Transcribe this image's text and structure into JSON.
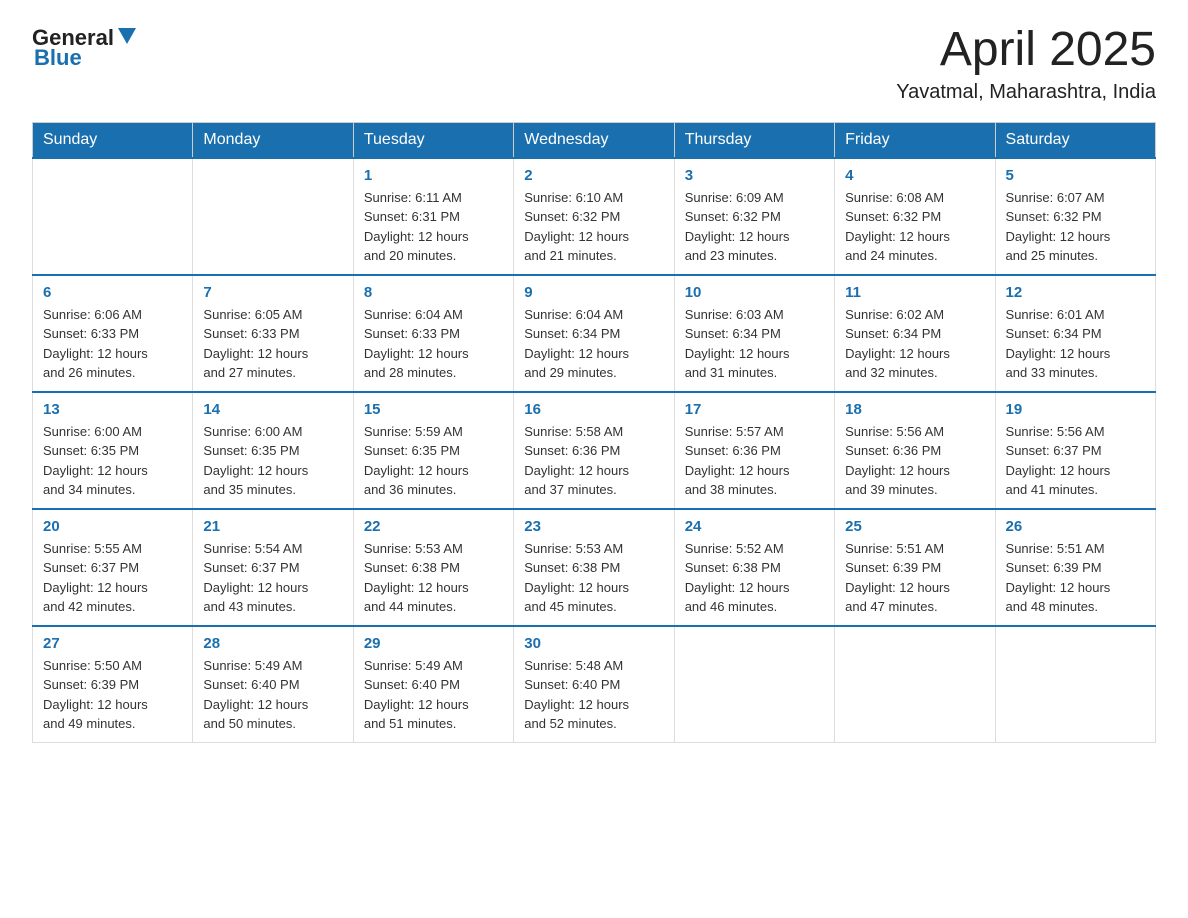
{
  "header": {
    "logo_general": "General",
    "logo_blue": "Blue",
    "month_year": "April 2025",
    "location": "Yavatmal, Maharashtra, India"
  },
  "days_of_week": [
    "Sunday",
    "Monday",
    "Tuesday",
    "Wednesday",
    "Thursday",
    "Friday",
    "Saturday"
  ],
  "weeks": [
    [
      {
        "day": "",
        "info": ""
      },
      {
        "day": "",
        "info": ""
      },
      {
        "day": "1",
        "info": "Sunrise: 6:11 AM\nSunset: 6:31 PM\nDaylight: 12 hours\nand 20 minutes."
      },
      {
        "day": "2",
        "info": "Sunrise: 6:10 AM\nSunset: 6:32 PM\nDaylight: 12 hours\nand 21 minutes."
      },
      {
        "day": "3",
        "info": "Sunrise: 6:09 AM\nSunset: 6:32 PM\nDaylight: 12 hours\nand 23 minutes."
      },
      {
        "day": "4",
        "info": "Sunrise: 6:08 AM\nSunset: 6:32 PM\nDaylight: 12 hours\nand 24 minutes."
      },
      {
        "day": "5",
        "info": "Sunrise: 6:07 AM\nSunset: 6:32 PM\nDaylight: 12 hours\nand 25 minutes."
      }
    ],
    [
      {
        "day": "6",
        "info": "Sunrise: 6:06 AM\nSunset: 6:33 PM\nDaylight: 12 hours\nand 26 minutes."
      },
      {
        "day": "7",
        "info": "Sunrise: 6:05 AM\nSunset: 6:33 PM\nDaylight: 12 hours\nand 27 minutes."
      },
      {
        "day": "8",
        "info": "Sunrise: 6:04 AM\nSunset: 6:33 PM\nDaylight: 12 hours\nand 28 minutes."
      },
      {
        "day": "9",
        "info": "Sunrise: 6:04 AM\nSunset: 6:34 PM\nDaylight: 12 hours\nand 29 minutes."
      },
      {
        "day": "10",
        "info": "Sunrise: 6:03 AM\nSunset: 6:34 PM\nDaylight: 12 hours\nand 31 minutes."
      },
      {
        "day": "11",
        "info": "Sunrise: 6:02 AM\nSunset: 6:34 PM\nDaylight: 12 hours\nand 32 minutes."
      },
      {
        "day": "12",
        "info": "Sunrise: 6:01 AM\nSunset: 6:34 PM\nDaylight: 12 hours\nand 33 minutes."
      }
    ],
    [
      {
        "day": "13",
        "info": "Sunrise: 6:00 AM\nSunset: 6:35 PM\nDaylight: 12 hours\nand 34 minutes."
      },
      {
        "day": "14",
        "info": "Sunrise: 6:00 AM\nSunset: 6:35 PM\nDaylight: 12 hours\nand 35 minutes."
      },
      {
        "day": "15",
        "info": "Sunrise: 5:59 AM\nSunset: 6:35 PM\nDaylight: 12 hours\nand 36 minutes."
      },
      {
        "day": "16",
        "info": "Sunrise: 5:58 AM\nSunset: 6:36 PM\nDaylight: 12 hours\nand 37 minutes."
      },
      {
        "day": "17",
        "info": "Sunrise: 5:57 AM\nSunset: 6:36 PM\nDaylight: 12 hours\nand 38 minutes."
      },
      {
        "day": "18",
        "info": "Sunrise: 5:56 AM\nSunset: 6:36 PM\nDaylight: 12 hours\nand 39 minutes."
      },
      {
        "day": "19",
        "info": "Sunrise: 5:56 AM\nSunset: 6:37 PM\nDaylight: 12 hours\nand 41 minutes."
      }
    ],
    [
      {
        "day": "20",
        "info": "Sunrise: 5:55 AM\nSunset: 6:37 PM\nDaylight: 12 hours\nand 42 minutes."
      },
      {
        "day": "21",
        "info": "Sunrise: 5:54 AM\nSunset: 6:37 PM\nDaylight: 12 hours\nand 43 minutes."
      },
      {
        "day": "22",
        "info": "Sunrise: 5:53 AM\nSunset: 6:38 PM\nDaylight: 12 hours\nand 44 minutes."
      },
      {
        "day": "23",
        "info": "Sunrise: 5:53 AM\nSunset: 6:38 PM\nDaylight: 12 hours\nand 45 minutes."
      },
      {
        "day": "24",
        "info": "Sunrise: 5:52 AM\nSunset: 6:38 PM\nDaylight: 12 hours\nand 46 minutes."
      },
      {
        "day": "25",
        "info": "Sunrise: 5:51 AM\nSunset: 6:39 PM\nDaylight: 12 hours\nand 47 minutes."
      },
      {
        "day": "26",
        "info": "Sunrise: 5:51 AM\nSunset: 6:39 PM\nDaylight: 12 hours\nand 48 minutes."
      }
    ],
    [
      {
        "day": "27",
        "info": "Sunrise: 5:50 AM\nSunset: 6:39 PM\nDaylight: 12 hours\nand 49 minutes."
      },
      {
        "day": "28",
        "info": "Sunrise: 5:49 AM\nSunset: 6:40 PM\nDaylight: 12 hours\nand 50 minutes."
      },
      {
        "day": "29",
        "info": "Sunrise: 5:49 AM\nSunset: 6:40 PM\nDaylight: 12 hours\nand 51 minutes."
      },
      {
        "day": "30",
        "info": "Sunrise: 5:48 AM\nSunset: 6:40 PM\nDaylight: 12 hours\nand 52 minutes."
      },
      {
        "day": "",
        "info": ""
      },
      {
        "day": "",
        "info": ""
      },
      {
        "day": "",
        "info": ""
      }
    ]
  ]
}
